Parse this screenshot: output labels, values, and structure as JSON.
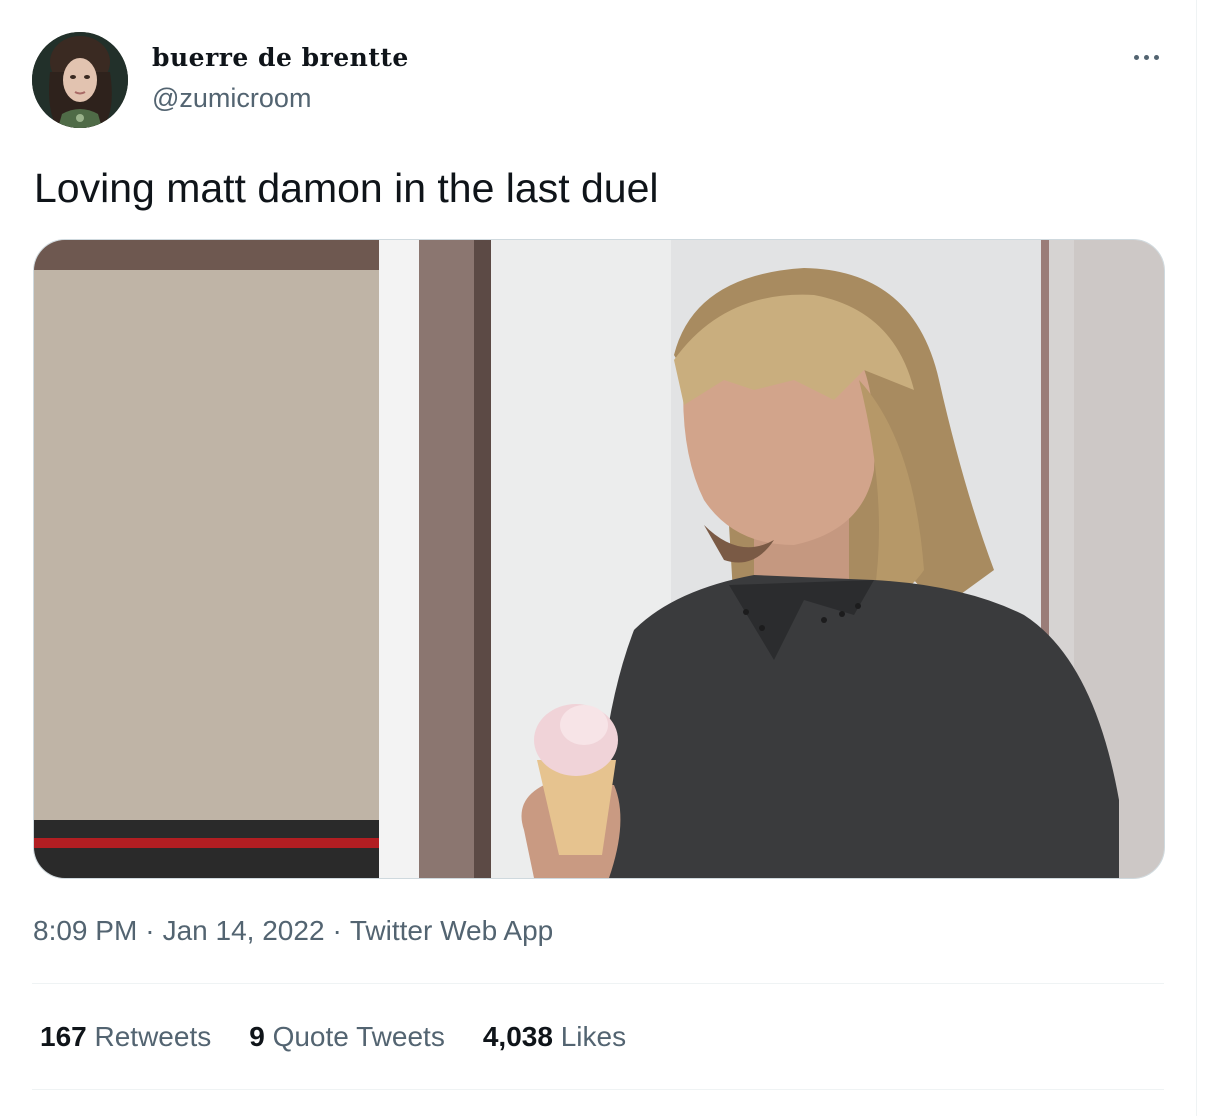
{
  "tweet": {
    "author": {
      "display_name": "buerre de brentte",
      "handle": "@zumicroom",
      "avatar": "profile-photo"
    },
    "text": "Loving matt damon in the last duel",
    "media": {
      "type": "photo",
      "description": "photo of a man with a long blond mullet in a dark polo shirt holding an ice cream cone"
    },
    "time": "8:09 PM",
    "date": "Jan 14, 2022",
    "separator": "·",
    "source": "Twitter Web App",
    "stats": {
      "retweets": {
        "count": "167",
        "label": "Retweets"
      },
      "quotes": {
        "count": "9",
        "label": "Quote Tweets"
      },
      "likes": {
        "count": "4,038",
        "label": "Likes"
      }
    },
    "more_icon": "ellipsis-icon"
  },
  "colors": {
    "text_primary": "#0f1419",
    "text_secondary": "#536471",
    "border": "#cfd9de",
    "divider": "#eff3f4"
  }
}
